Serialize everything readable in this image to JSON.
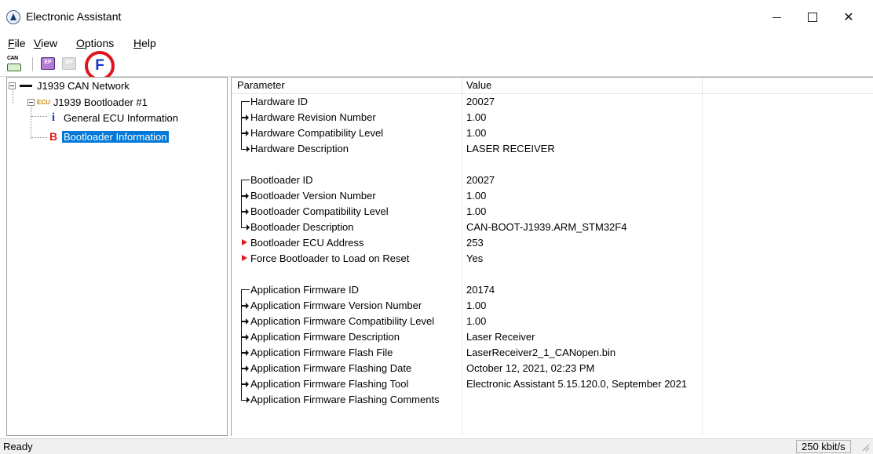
{
  "window": {
    "title": "Electronic Assistant"
  },
  "menu": [
    {
      "label": "File",
      "underline": "F",
      "rest": "ile"
    },
    {
      "label": "View",
      "underline": "V",
      "rest": "iew"
    },
    {
      "label": "Options",
      "underline": "O",
      "rest": "ptions"
    },
    {
      "label": "Help",
      "underline": "H",
      "rest": "elp"
    }
  ],
  "toolbar": {
    "can_label": "CAN",
    "ep_label": "EP",
    "flash_label": "F",
    "highlight_color": "#e0141c"
  },
  "tree": {
    "network": "J1939 CAN Network",
    "ecu_tag": "ECU",
    "ecu": "J1939 Bootloader #1",
    "info": "General ECU Information",
    "boot": "Bootloader Information",
    "info_icon": "i",
    "boot_icon": "B"
  },
  "table": {
    "headers": [
      "Parameter",
      "Value"
    ],
    "rows": [
      {
        "p": "Hardware ID",
        "v": "20027",
        "mark": "top"
      },
      {
        "p": "Hardware Revision Number",
        "v": "1.00",
        "mark": "mid"
      },
      {
        "p": "Hardware Compatibility Level",
        "v": "1.00",
        "mark": "mid"
      },
      {
        "p": "Hardware Description",
        "v": "LASER RECEIVER",
        "mark": "end"
      },
      {
        "p": "",
        "v": "",
        "mark": ""
      },
      {
        "p": "Bootloader ID",
        "v": "20027",
        "mark": "top"
      },
      {
        "p": "Bootloader Version Number",
        "v": "1.00",
        "mark": "mid"
      },
      {
        "p": "Bootloader Compatibility Level",
        "v": "1.00",
        "mark": "mid"
      },
      {
        "p": "Bootloader Description",
        "v": "CAN-BOOT-J1939.ARM_STM32F4",
        "mark": "end"
      },
      {
        "p": "Bootloader ECU Address",
        "v": "253",
        "mark": "red"
      },
      {
        "p": "Force Bootloader to Load on Reset",
        "v": "Yes",
        "mark": "red"
      },
      {
        "p": "",
        "v": "",
        "mark": ""
      },
      {
        "p": "Application Firmware ID",
        "v": "20174",
        "mark": "top"
      },
      {
        "p": "Application Firmware Version Number",
        "v": "1.00",
        "mark": "mid"
      },
      {
        "p": "Application Firmware Compatibility Level",
        "v": "1.00",
        "mark": "mid"
      },
      {
        "p": "Application Firmware Description",
        "v": "Laser Receiver",
        "mark": "mid"
      },
      {
        "p": "Application Firmware Flash File",
        "v": "LaserReceiver2_1_CANopen.bin",
        "mark": "mid"
      },
      {
        "p": "Application Firmware Flashing Date",
        "v": "October 12, 2021, 02:23 PM",
        "mark": "mid"
      },
      {
        "p": "Application Firmware Flashing Tool",
        "v": "Electronic Assistant 5.15.120.0, September 2021",
        "mark": "mid"
      },
      {
        "p": "Application Firmware Flashing Comments",
        "v": "",
        "mark": "end"
      }
    ]
  },
  "status": {
    "text": "Ready",
    "rate": "250 kbit/s"
  }
}
